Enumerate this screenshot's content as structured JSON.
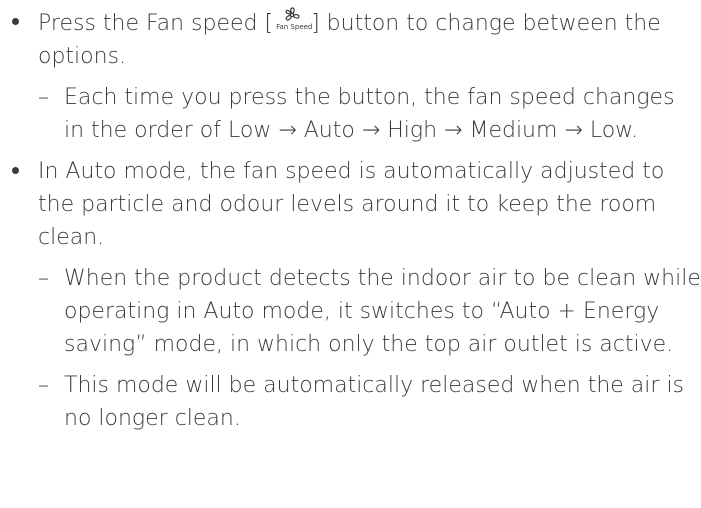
{
  "section1": {
    "bullet_before": "Press the Fan speed [",
    "icon_name": "fan-icon",
    "icon_caption": "Fan Speed",
    "bullet_after": "] button to change between the options.",
    "sub_items": [
      "Each time you press the button, the fan speed changes in the order of Low → Auto → High → Medium → Low."
    ]
  },
  "section2": {
    "bullet": "In Auto mode, the fan speed is automatically adjusted to the particle and odour levels around it to keep the room clean.",
    "sub_items": [
      "When the product detects the indoor air to be clean while operating in Auto mode, it switches to “Auto + Energy saving” mode, in which only the top air outlet is active.",
      "This mode will be automatically released when the air is no longer clean."
    ]
  },
  "dash_symbol": "–"
}
